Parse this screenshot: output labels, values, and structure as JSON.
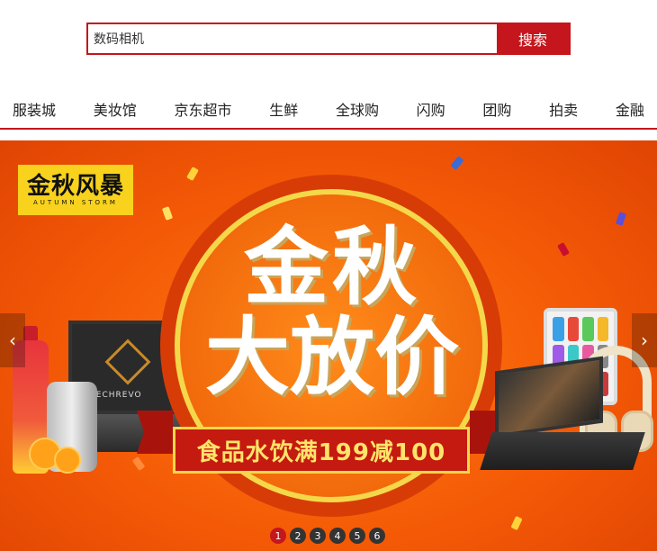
{
  "search": {
    "value": "数码相机",
    "button_label": "搜索"
  },
  "nav": {
    "items": [
      {
        "label": "服装城"
      },
      {
        "label": "美妆馆"
      },
      {
        "label": "京东超市"
      },
      {
        "label": "生鲜"
      },
      {
        "label": "全球购"
      },
      {
        "label": "闪购"
      },
      {
        "label": "团购"
      },
      {
        "label": "拍卖"
      },
      {
        "label": "金融"
      }
    ]
  },
  "banner": {
    "logo_text": "金秋风暴",
    "logo_subtext": "AUTUMN STORM",
    "headline_line1": "金秋",
    "headline_line2": "大放价",
    "promo": "食品水饮满199减100",
    "laptop_brand": "MECHREVO",
    "prev_arrow": "‹",
    "next_arrow": "›",
    "pages": [
      "1",
      "2",
      "3",
      "4",
      "5",
      "6"
    ],
    "active_page": "1"
  },
  "colors": {
    "accent": "#c4161c",
    "banner_orange": "#f45a06",
    "badge_yellow": "#f8d21c",
    "promo_text": "#ffe46a"
  }
}
